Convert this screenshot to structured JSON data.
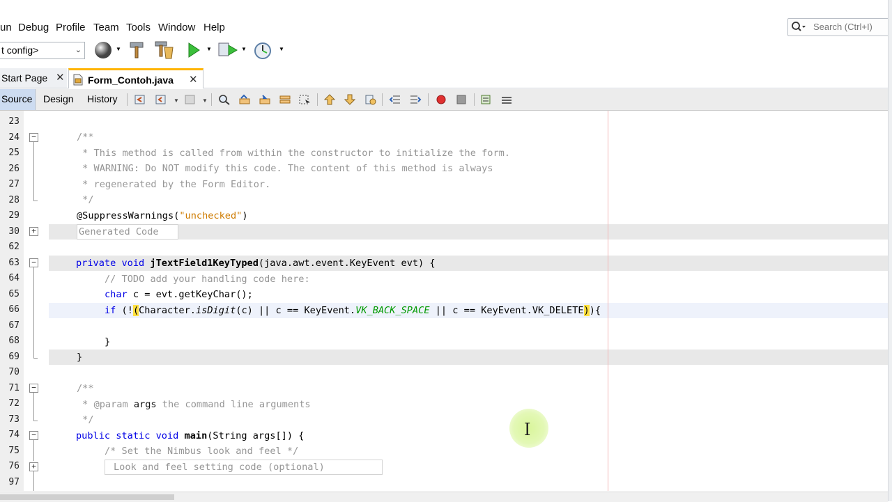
{
  "menu": [
    "un",
    "Debug",
    "Profile",
    "Team",
    "Tools",
    "Window",
    "Help"
  ],
  "search": {
    "placeholder": "Search (Ctrl+I)"
  },
  "toolbar": {
    "config_value": "t config>"
  },
  "file_tabs": [
    {
      "label": "Start Page",
      "active": false
    },
    {
      "label": "Form_Contoh.java",
      "active": true
    }
  ],
  "editor_tabs": [
    "Source",
    "Design",
    "History"
  ],
  "line_numbers": [
    "23",
    "24",
    "25",
    "26",
    "27",
    "28",
    "29",
    "30",
    "62",
    "63",
    "64",
    "65",
    "66",
    "67",
    "68",
    "69",
    "70",
    "71",
    "72",
    "73",
    "74",
    "75",
    "76",
    "97"
  ],
  "code": {
    "l24": "/**",
    "l25": " * This method is called from within the constructor to initialize the form.",
    "l26": " * WARNING: Do NOT modify this code. The content of this method is always",
    "l27": " * regenerated by the Form Editor.",
    "l28": " */",
    "l29_annot": "@SuppressWarnings(",
    "l29_str": "\"unchecked\"",
    "l29_end": ")",
    "l30": "Generated Code",
    "l63_kw": "private void",
    "l63_name": "jTextField1KeyTyped",
    "l63_rest": "(java.awt.event.KeyEvent evt) {",
    "l64": "// TODO add your handling code here:",
    "l65_kw": "char",
    "l65_rest": " c = evt.getKeyChar();",
    "l66_kw": "if",
    "l66_a": " (!",
    "l66_paren_open": "(",
    "l66_b": "Character.",
    "l66_isdigit": "isDigit",
    "l66_c": "(c) || c == KeyEvent.",
    "l66_vk": "VK_BACK_SPACE",
    "l66_d": " || c == KeyEvent.VK_DELETE",
    "l66_paren_close": ")",
    "l66_e": "){",
    "l68": "}",
    "l69": "}",
    "l71": "/**",
    "l72_a": " * ",
    "l72_param": "@param",
    "l72_args": " args",
    "l72_rest": " the command line arguments",
    "l73": " */",
    "l74_kw": "public static void",
    "l74_name": " main",
    "l74_rest": "(String args[]) {",
    "l75": "/* Set the Nimbus look and feel */",
    "l76": "Look and feel setting code (optional)"
  },
  "colors": {
    "keyword": "#0000e6",
    "comment": "#969696",
    "string": "#ce7b00",
    "constant": "#009900",
    "bracket_match": "#ffe040",
    "tab_accent": "#ffb400"
  }
}
